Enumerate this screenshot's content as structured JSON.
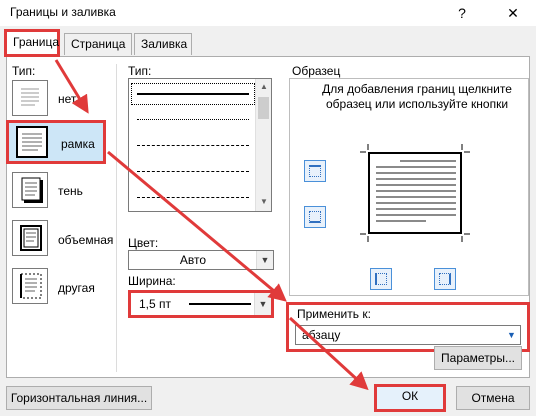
{
  "window": {
    "title": "Границы и заливка",
    "help_label": "?",
    "close_label": "✕"
  },
  "tabs": [
    {
      "label": "Граница",
      "active": true
    },
    {
      "label": "Страница",
      "active": false
    },
    {
      "label": "Заливка",
      "active": false
    }
  ],
  "type_section": {
    "label": "Тип:",
    "items": [
      {
        "label": "нет",
        "icon": "no-border-icon"
      },
      {
        "label": "рамка",
        "icon": "box-border-icon",
        "selected": true
      },
      {
        "label": "тень",
        "icon": "shadow-border-icon"
      },
      {
        "label": "объемная",
        "icon": "3d-border-icon"
      },
      {
        "label": "другая",
        "icon": "custom-border-icon"
      }
    ]
  },
  "style_section": {
    "label": "Тип:"
  },
  "color": {
    "label": "Цвет:",
    "value": "Авто"
  },
  "width": {
    "label": "Ширина:",
    "value": "1,5 пт"
  },
  "preview": {
    "label": "Образец",
    "help": "Для добавления границ щелкните образец или используйте кнопки"
  },
  "apply_to": {
    "label": "Применить к:",
    "value": "абзацу"
  },
  "buttons": {
    "options": "Параметры...",
    "horizontal_line": "Горизонтальная линия...",
    "ok": "ОК",
    "cancel": "Отмена"
  },
  "colors": {
    "highlight": "#e03a3a",
    "selection": "#cde6f7"
  }
}
